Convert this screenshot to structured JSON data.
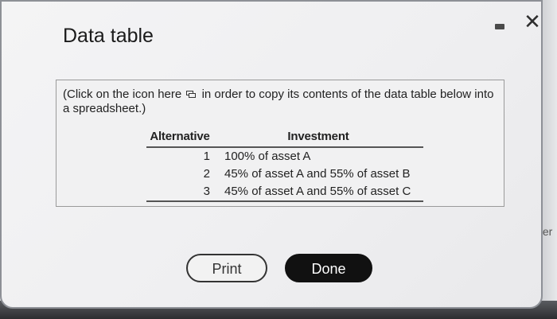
{
  "window": {
    "title": "Data table"
  },
  "controls": {
    "minimize_icon": "minimize-icon",
    "close_icon": "close-icon"
  },
  "panel": {
    "hint_before": "(Click on the icon here",
    "hint_after": "in order to copy its contents of the data table below into a spreadsheet.)",
    "copy_icon": "copy-icon"
  },
  "table": {
    "headers": [
      "Alternative",
      "Investment"
    ],
    "rows": [
      [
        "1",
        "100% of asset A"
      ],
      [
        "2",
        "45% of asset A and 55% of asset B"
      ],
      [
        "3",
        "45% of asset A and 55% of asset C"
      ]
    ]
  },
  "buttons": {
    "print_label": "Print",
    "done_label": "Done"
  },
  "background": {
    "partial_text": "ter"
  },
  "colors": {
    "done_bg": "#111111",
    "dialog_bg": "#f1f1f2"
  }
}
